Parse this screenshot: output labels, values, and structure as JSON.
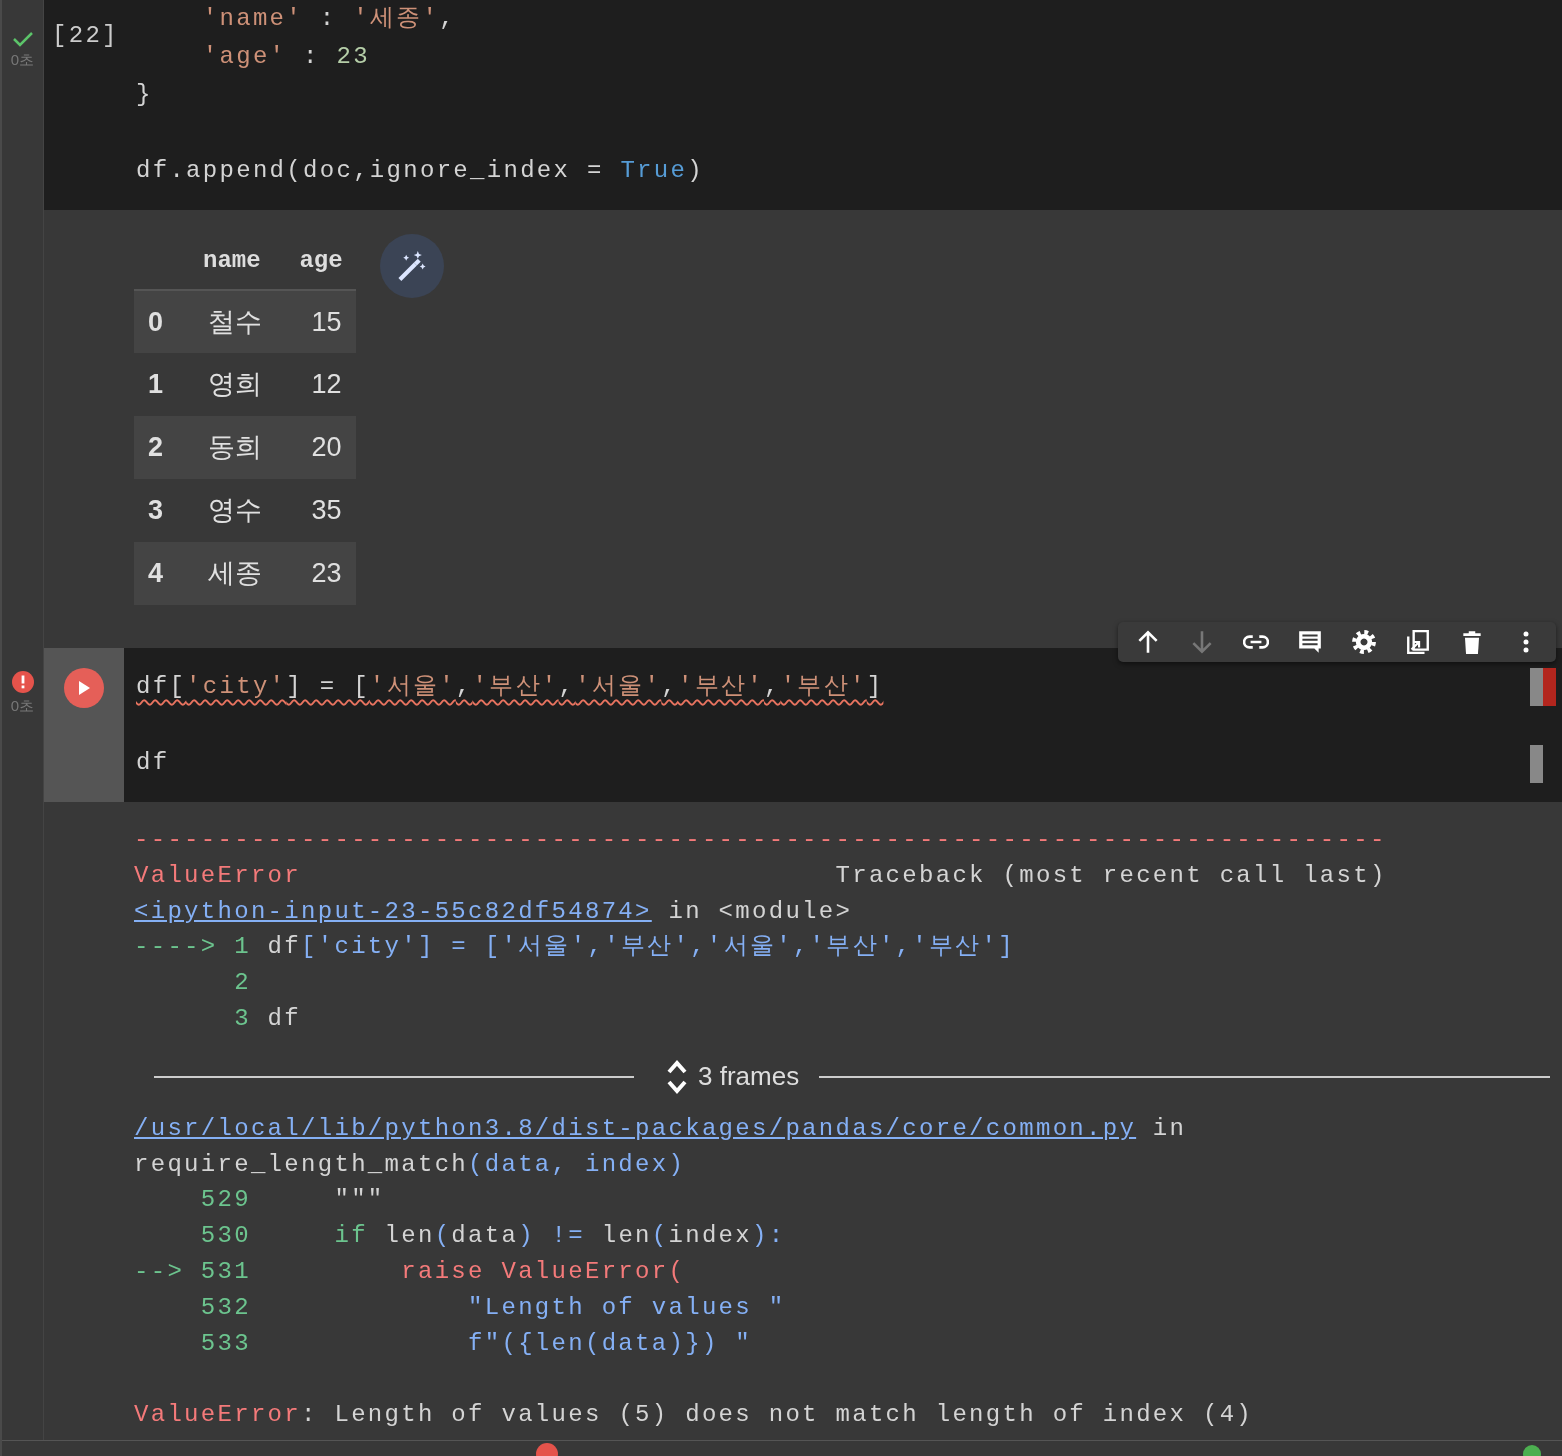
{
  "cell_1": {
    "kind": "success",
    "time": "0초",
    "execution_count": "[22]",
    "lines": [
      {
        "space_before": false,
        "tokens": [
          {
            "t": "    'name'",
            "kind": "str"
          },
          {
            "t": " : ",
            "kind": "plain"
          },
          {
            "t": "'세종'",
            "kind": "str"
          },
          {
            "t": ",",
            "kind": "plain"
          }
        ]
      },
      {
        "space_before": false,
        "tokens": [
          {
            "t": "    'age'",
            "kind": "str"
          },
          {
            "t": " : ",
            "kind": "plain"
          },
          {
            "t": "23",
            "kind": "num"
          }
        ]
      },
      {
        "space_before": false,
        "tokens": [
          {
            "t": "}",
            "kind": "plain"
          }
        ]
      },
      {
        "space_before": true,
        "tokens": [
          {
            "t": "df.append(doc,ignore_index = ",
            "kind": "plain"
          },
          {
            "t": "True",
            "kind": "kw"
          },
          {
            "t": ")",
            "kind": "plain"
          }
        ]
      }
    ]
  },
  "output_1": {
    "columns": [
      "name",
      "age"
    ],
    "rows": [
      {
        "index": "0",
        "name": "철수",
        "age": "15"
      },
      {
        "index": "1",
        "name": "영희",
        "age": "12"
      },
      {
        "index": "2",
        "name": "동희",
        "age": "20"
      },
      {
        "index": "3",
        "name": "영수",
        "age": "35"
      },
      {
        "index": "4",
        "name": "세종",
        "age": "23"
      }
    ]
  },
  "cell_2": {
    "kind": "error",
    "time": "0초",
    "toolbar": [
      {
        "kind": "up",
        "disabled": false
      },
      {
        "kind": "down",
        "disabled": true
      },
      {
        "kind": "link",
        "disabled": false
      },
      {
        "kind": "comment",
        "disabled": false
      },
      {
        "kind": "settings",
        "disabled": false
      },
      {
        "kind": "mirror",
        "disabled": false
      },
      {
        "kind": "delete",
        "disabled": false
      },
      {
        "kind": "more",
        "disabled": false
      }
    ],
    "lines": [
      {
        "space_before": false,
        "error_underline": true,
        "tokens": [
          {
            "t": "df[",
            "kind": "plain"
          },
          {
            "t": "'city'",
            "kind": "str"
          },
          {
            "t": "] = [",
            "kind": "plain"
          },
          {
            "t": "'서울'",
            "kind": "str"
          },
          {
            "t": ",",
            "kind": "plain"
          },
          {
            "t": "'부산'",
            "kind": "str"
          },
          {
            "t": ",",
            "kind": "plain"
          },
          {
            "t": "'서울'",
            "kind": "str"
          },
          {
            "t": ",",
            "kind": "plain"
          },
          {
            "t": "'부산'",
            "kind": "str"
          },
          {
            "t": ",",
            "kind": "plain"
          },
          {
            "t": "'부산'",
            "kind": "str"
          },
          {
            "t": "]",
            "kind": "plain"
          }
        ]
      },
      {
        "space_before": true,
        "error_underline": false,
        "tokens": [
          {
            "t": "df",
            "kind": "plain"
          }
        ]
      }
    ]
  },
  "error_output": {
    "traceback": [
      {
        "space_before": false,
        "tokens": [
          {
            "t": "---------------------------------------------------------------------------",
            "kind": "err"
          }
        ]
      },
      {
        "space_before": false,
        "tokens": [
          {
            "t": "ValueError",
            "kind": "err"
          },
          {
            "t": "                                Traceback (most recent call last)",
            "kind": "plain"
          }
        ]
      },
      {
        "space_before": false,
        "tokens": [
          {
            "t": "<ipython-input-23-55c82df54874>",
            "kind": "link"
          },
          {
            "t": " in <module>",
            "kind": "plain"
          }
        ]
      },
      {
        "space_before": false,
        "tokens": [
          {
            "t": "----> 1",
            "kind": "green"
          },
          {
            "t": " df",
            "kind": "plain"
          },
          {
            "t": "['city'] = ['서울','부산','서울','부산','부산']",
            "kind": "blue"
          }
        ]
      },
      {
        "space_before": false,
        "tokens": [
          {
            "t": "      2",
            "kind": "green"
          }
        ]
      },
      {
        "space_before": false,
        "tokens": [
          {
            "t": "      3",
            "kind": "green"
          },
          {
            "t": " df",
            "kind": "plain"
          }
        ]
      }
    ],
    "frames_label": "3 frames",
    "frame_lines": [
      {
        "space_before": false,
        "tokens": [
          {
            "t": "/usr/local/lib/python3.8/dist-packages/pandas/core/common.py",
            "kind": "link"
          },
          {
            "t": " in",
            "kind": "plain"
          }
        ]
      },
      {
        "space_before": false,
        "tokens": [
          {
            "t": "require_length_match",
            "kind": "plain"
          },
          {
            "t": "(data, index)",
            "kind": "blue"
          }
        ]
      },
      {
        "space_before": false,
        "tokens": [
          {
            "t": "    529",
            "kind": "green"
          },
          {
            "t": "     \"\"\"",
            "kind": "plain"
          }
        ]
      },
      {
        "space_before": false,
        "tokens": [
          {
            "t": "    530",
            "kind": "green"
          },
          {
            "t": "     if",
            "kind": "green"
          },
          {
            "t": " len",
            "kind": "plain"
          },
          {
            "t": "(",
            "kind": "blue"
          },
          {
            "t": "data",
            "kind": "plain"
          },
          {
            "t": ") != ",
            "kind": "blue"
          },
          {
            "t": "len",
            "kind": "plain"
          },
          {
            "t": "(",
            "kind": "blue"
          },
          {
            "t": "index",
            "kind": "plain"
          },
          {
            "t": "):",
            "kind": "blue"
          }
        ]
      },
      {
        "space_before": false,
        "tokens": [
          {
            "t": "--> 531",
            "kind": "green"
          },
          {
            "t": "         raise ValueError(",
            "kind": "err"
          }
        ]
      },
      {
        "space_before": false,
        "tokens": [
          {
            "t": "    532",
            "kind": "green"
          },
          {
            "t": "             \"Length of values \"",
            "kind": "blue"
          }
        ]
      },
      {
        "space_before": false,
        "tokens": [
          {
            "t": "    533",
            "kind": "green"
          },
          {
            "t": "             f\"({len(data)}) \"",
            "kind": "blue"
          }
        ]
      },
      {
        "space_before": true,
        "tokens": [
          {
            "t": "ValueError",
            "kind": "err"
          },
          {
            "t": ": Length of values (5) does not match length of index (4)",
            "kind": "plain"
          }
        ]
      }
    ]
  }
}
